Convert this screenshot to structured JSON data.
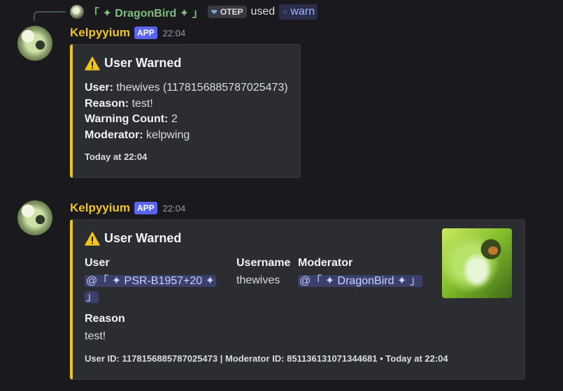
{
  "reply": {
    "name": "「 ✦ DragonBird ✦ 」",
    "tag_label": "OTEP",
    "used_label": "used",
    "command": "warn"
  },
  "messages": [
    {
      "author": "Kelpyyium",
      "badge": "APP",
      "time": "22:04",
      "embed": {
        "title": "User Warned",
        "lines": [
          {
            "label": "User:",
            "value": " thewives (1178156885787025473)"
          },
          {
            "label": "Reason:",
            "value": " test!"
          },
          {
            "label": "Warning Count:",
            "value": " 2"
          },
          {
            "label": "Moderator:",
            "value": " kelpwing"
          }
        ],
        "footer": "Today at 22:04"
      }
    },
    {
      "author": "Kelpyyium",
      "badge": "APP",
      "time": "22:04",
      "embed": {
        "title": "User Warned",
        "fields": {
          "user_name": "User",
          "user_value_1": "@「 ✦ PSR-B1957+20 ✦",
          "user_value_2": "」",
          "username_name": "Username",
          "username_value": "thewives",
          "moderator_name": "Moderator",
          "moderator_value": "@「 ✦ DragonBird ✦ 」",
          "reason_name": "Reason",
          "reason_value": "test!"
        },
        "footer": "User ID: 1178156885787025473 | Moderator ID: 851136131071344681 • Today at 22:04",
        "thumbnail": "dragon-thumbnail"
      }
    }
  ],
  "colors": {
    "accent": "#f0c419",
    "app_badge": "#5865f2",
    "mention_bg": "#3b3f6b",
    "background": "#1a1a1e",
    "embed_bg": "#2b2d31"
  }
}
